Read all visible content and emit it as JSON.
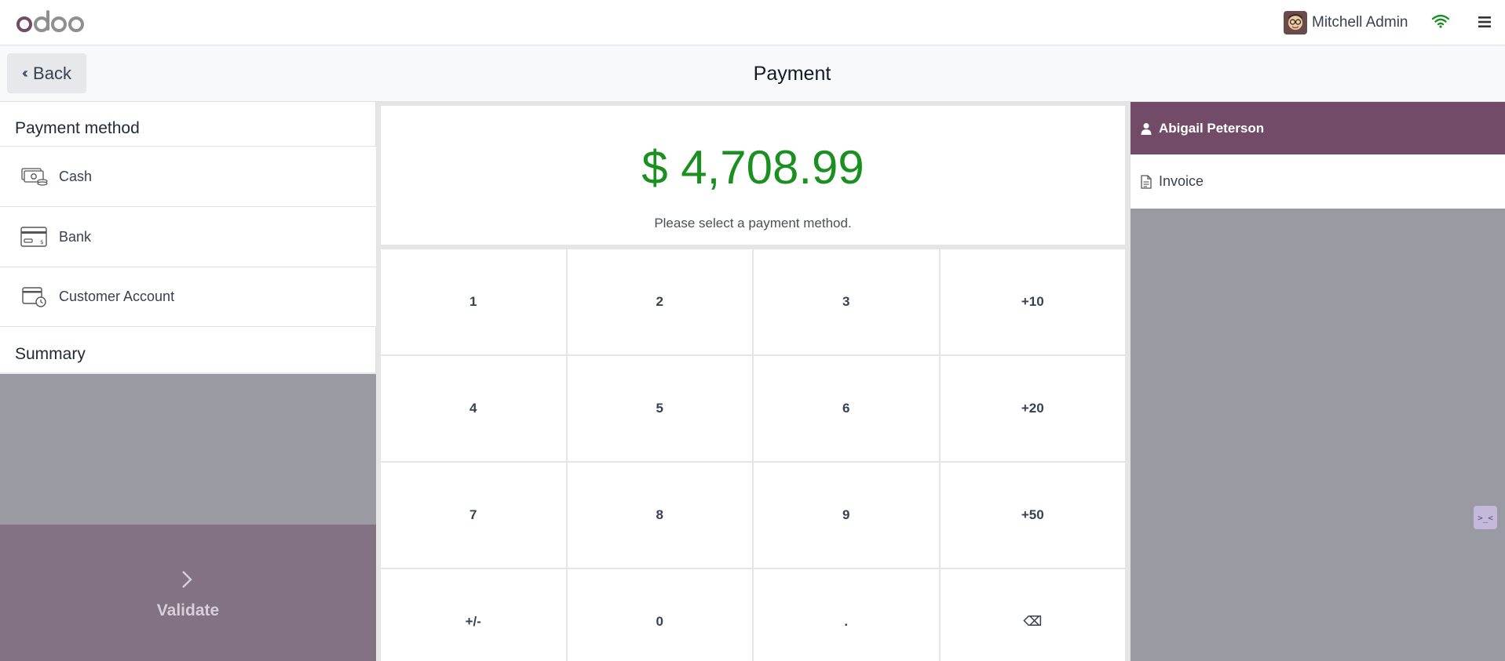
{
  "app": {
    "logo_text": "odoo"
  },
  "topbar": {
    "user_name": "Mitchell Admin",
    "icons": [
      "avatar",
      "wifi-icon",
      "hamburger-menu-icon"
    ]
  },
  "controlbar": {
    "back_label": "Back",
    "title": "Payment"
  },
  "left_panel": {
    "payment_method_title": "Payment method",
    "payment_methods": [
      {
        "label": "Cash",
        "icon": "cash-icon"
      },
      {
        "label": "Bank",
        "icon": "bank-card-icon"
      },
      {
        "label": "Customer Account",
        "icon": "customer-account-icon"
      }
    ],
    "summary_title": "Summary",
    "validate_label": "Validate"
  },
  "center_panel": {
    "amount": "$ 4,708.99",
    "hint": "Please select a payment method.",
    "keys": [
      "1",
      "2",
      "3",
      "+10",
      "4",
      "5",
      "6",
      "+20",
      "7",
      "8",
      "9",
      "+50",
      "+/-",
      "0",
      ".",
      "⌫"
    ]
  },
  "right_panel": {
    "customer_name": "Abigail Peterson",
    "invoice_label": "Invoice"
  },
  "colors": {
    "brand": "#714b67",
    "amount": "#1a9020",
    "validate_bg": "#837184",
    "overlay_gray": "#9a9aa3"
  }
}
